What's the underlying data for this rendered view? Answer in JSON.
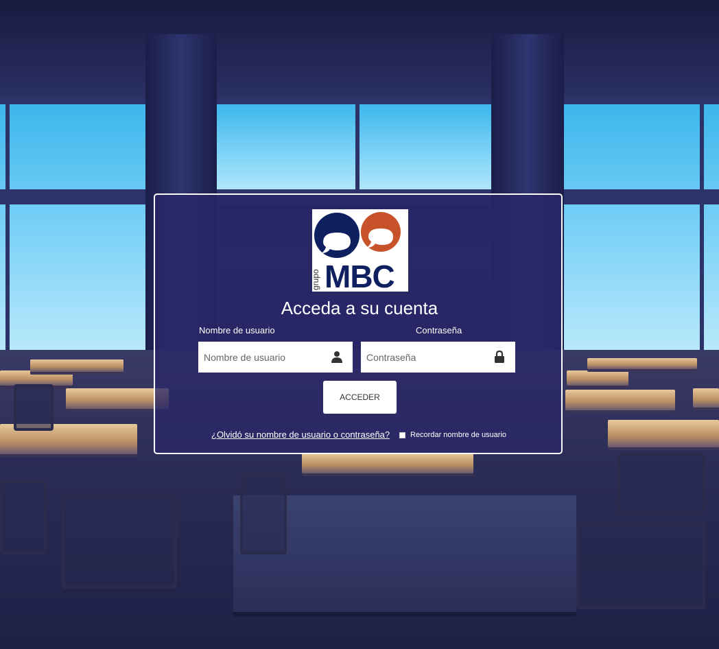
{
  "logo": {
    "alt": "grupo MBC",
    "brand": "MBC",
    "sub": "grupo",
    "colors": {
      "navy": "#0f2060",
      "orange": "#c8532a"
    }
  },
  "login": {
    "title": "Acceda a su cuenta",
    "username_label": "Nombre de usuario",
    "username_placeholder": "Nombre de usuario",
    "username_icon": "user-icon",
    "password_label": "Contraseña",
    "password_placeholder": "Contraseña",
    "password_icon": "lock-icon",
    "submit_label": "ACCEDER",
    "forgot_link": "¿Olvidó su nombre de usuario o contraseña?",
    "remember_label": "Recordar nombre de usuario",
    "remember_checked": false
  }
}
